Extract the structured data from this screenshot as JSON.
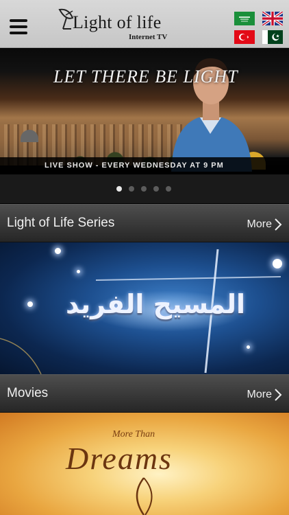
{
  "header": {
    "logo_title": "Light of life",
    "logo_subtitle": "Internet TV",
    "languages": [
      "Arabic",
      "English",
      "Turkish",
      "Urdu"
    ]
  },
  "banner": {
    "title": "LET THERE BE LIGHT",
    "caption": "LIVE SHOW - EVERY WEDNESDAY AT 9 PM",
    "slide_count": 5,
    "active_slide": 1
  },
  "sections": [
    {
      "title": "Light of Life Series",
      "more_label": "More",
      "featured_title": "المسيح الفريد"
    },
    {
      "title": "Movies",
      "more_label": "More",
      "featured_title_small": "More Than",
      "featured_title_big": "Dreams"
    }
  ],
  "colors": {
    "header_bg": "#cfcfcf",
    "section_header_bg": "#3a3a3a",
    "accent_text": "#f0f0f0"
  }
}
